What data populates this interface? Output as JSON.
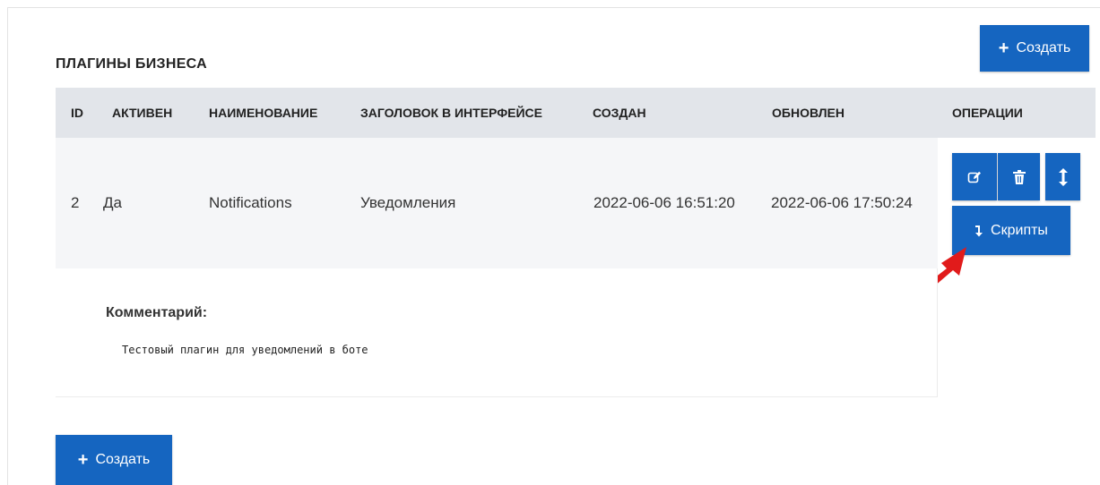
{
  "section_title": "ПЛАГИНЫ БИЗНЕСА",
  "buttons": {
    "create_top": "Создать",
    "create_bottom": "Создать",
    "scripts": "Скрипты"
  },
  "table": {
    "headers": [
      "ID",
      "АКТИВЕН",
      "НАИМЕНОВАНИЕ",
      "ЗАГОЛОВОК В ИНТЕРФЕЙСЕ",
      "СОЗДАН",
      "ОБНОВЛЕН",
      "ОПЕРАЦИИ"
    ],
    "rows": [
      {
        "id": "2",
        "active": "Да",
        "name": "Notifications",
        "title": "Уведомления",
        "created": "2022-06-06 16:51:20",
        "updated": "2022-06-06 17:50:24",
        "comment_label": "Комментарий:",
        "comment": "Тестовый плагин для уведомлений в боте"
      }
    ]
  },
  "icons": {
    "plus": "plus-icon",
    "edit": "edit-icon",
    "delete": "trash-icon",
    "move": "vertical-arrows-icon",
    "scripts": "arrow-down-return-icon",
    "annotation": "red-arrow-pointer"
  },
  "colors": {
    "primary": "#1565c0",
    "header_bg": "#e2e5ea",
    "row_bg": "#f5f6f8",
    "annotation": "#e11b1b"
  }
}
